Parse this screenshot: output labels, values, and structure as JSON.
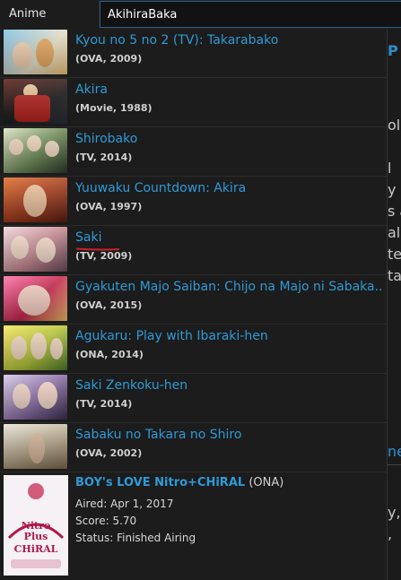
{
  "search": {
    "category": "Anime",
    "query": "AkihiraBaka"
  },
  "results": [
    {
      "title": "Kyou no 5 no 2 (TV): Takarabako",
      "meta": "(OVA, 2009)"
    },
    {
      "title": "Akira",
      "meta": "(Movie, 1988)"
    },
    {
      "title": "Shirobako",
      "meta": "(TV, 2014)"
    },
    {
      "title": "Yuuwaku Countdown: Akira",
      "meta": "(OVA, 1997)"
    },
    {
      "title": "Saki",
      "meta": "(TV, 2009)"
    },
    {
      "title": "Gyakuten Majo Saiban: Chijo na Majo ni Sabaka...",
      "meta": "(OVA, 2015)"
    },
    {
      "title": "Agukaru: Play with Ibaraki-hen",
      "meta": "(ONA, 2014)"
    },
    {
      "title": "Saki Zenkoku-hen",
      "meta": "(TV, 2014)"
    },
    {
      "title": "Sabaku no Takara no Shiro",
      "meta": "(OVA, 2002)"
    }
  ],
  "featured": {
    "title": "BOY's LOVE Nitro+CHiRAL",
    "kind": "(ONA)",
    "aired": "Aired: Apr 1, 2017",
    "score": "Score: 5.70",
    "status": "Status: Finished Airing",
    "logo_text": "NitroPlus CHiRAL"
  },
  "background": {
    "fragments": [
      "P",
      "ol",
      "l",
      "y",
      "s a",
      "al",
      "te",
      "ta",
      "ne",
      "y,",
      ","
    ]
  },
  "colors": {
    "link": "#2e9ad6",
    "underline": "#d0202a"
  }
}
